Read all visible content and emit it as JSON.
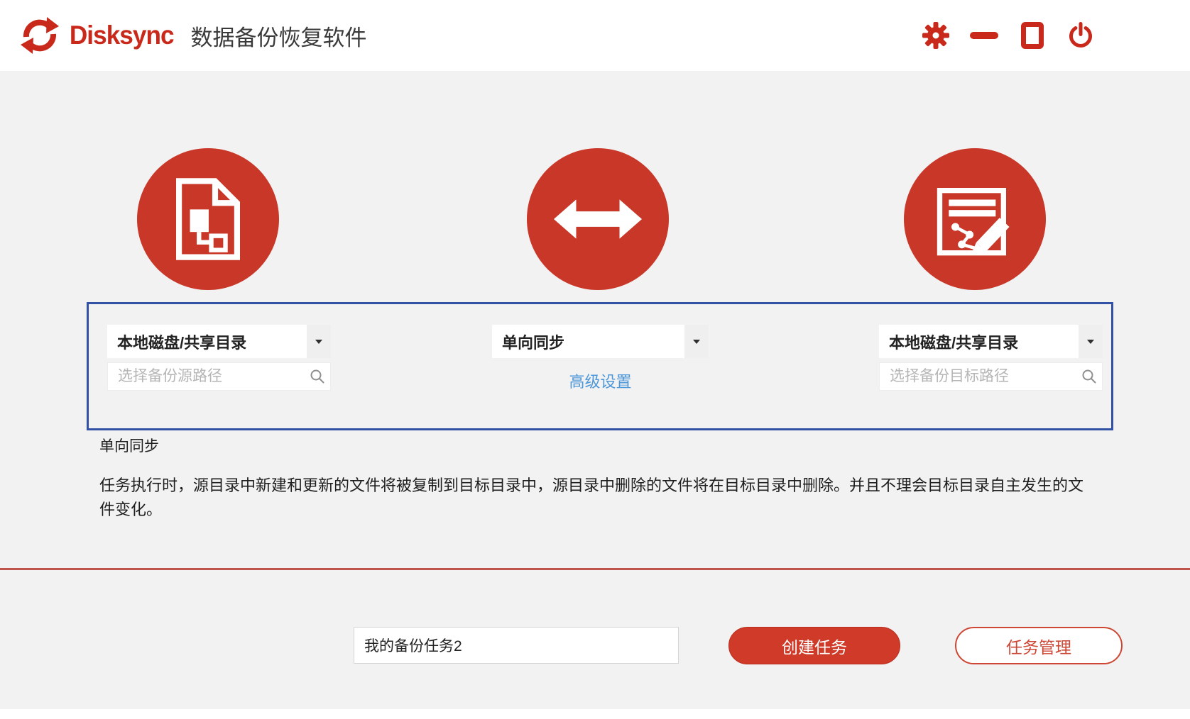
{
  "header": {
    "brand": "Disksync",
    "title": "数据备份恢复软件",
    "controls": {
      "settings_icon": "gear-icon",
      "minimize_icon": "minus-icon",
      "maximize_icon": "square-icon",
      "power_icon": "power-icon"
    }
  },
  "source": {
    "icon": "document-tree-icon",
    "type_selected": "本地磁盘/共享目录",
    "path_placeholder": "选择备份源路径",
    "search_icon": "search-icon"
  },
  "sync": {
    "icon": "double-arrow-icon",
    "mode_selected": "单向同步",
    "advanced_label": "高级设置"
  },
  "target": {
    "icon": "edit-report-icon",
    "type_selected": "本地磁盘/共享目录",
    "path_placeholder": "选择备份目标路径",
    "search_icon": "search-icon"
  },
  "info": {
    "mode_label": "单向同步",
    "description": "任务执行时，源目录中新建和更新的文件将被复制到目标目录中，源目录中删除的文件将在目标目录中删除。并且不理会目标目录自主发生的文件变化。"
  },
  "footer": {
    "task_name_value": "我的备份任务2",
    "create_button": "创建任务",
    "manage_button": "任务管理"
  },
  "colors": {
    "accent_red": "#c9291b",
    "circle_red": "#c83728",
    "button_red": "#cf3a29",
    "divider_red": "#c0544c",
    "selection_border_blue": "#3452a5",
    "link_blue": "#4e97d8",
    "body_background": "#f2f2f2"
  }
}
